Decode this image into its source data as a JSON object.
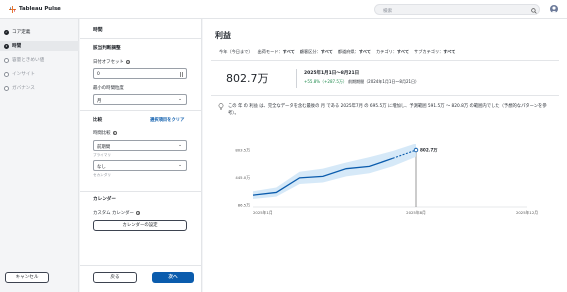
{
  "app": {
    "brand": "Tableau Pulse",
    "search_placeholder": "検索"
  },
  "steps": [
    {
      "label": "コア定義",
      "state": "done"
    },
    {
      "label": "時間",
      "state": "active"
    },
    {
      "label": "容量ときめい値",
      "state": "todo"
    },
    {
      "label": "インサイト",
      "state": "todo"
    },
    {
      "label": "ガバナンス",
      "state": "todo"
    }
  ],
  "config": {
    "title": "時間",
    "section1": "該当判断調整",
    "offset_label": "日付オフセット",
    "offset_value": "0",
    "granularity_label": "最小の時間粒度",
    "granularity_value": "月",
    "compare_head": "比較",
    "clear_link": "選択項目をクリア",
    "time_compare_label": "時間比較",
    "time_compare_value": "前期間",
    "primary_sub": "プライマリ",
    "second_value": "なし",
    "secondary_sub": "セカンダリ",
    "calendar_head": "カレンダー",
    "custom_cal_label": "カスタム カレンダー",
    "custom_cal_button": "カレンダーの設定",
    "cancel": "キャンセル",
    "back": "戻る",
    "next": "次へ"
  },
  "preview": {
    "title": "利益",
    "filters": [
      {
        "name": "今年（今日まで）",
        "value": ""
      },
      {
        "name": "出荷モード",
        "value": "すべて"
      },
      {
        "name": "顧客区分",
        "value": "すべて"
      },
      {
        "name": "都道府県",
        "value": "すべて"
      },
      {
        "name": "カテゴリ",
        "value": "すべて"
      },
      {
        "name": "サブカテゴリ",
        "value": "すべて"
      }
    ],
    "big_value": "802.7万",
    "range": "2025年1月1日～8月21日",
    "delta_up": "+55.8%（+287.5万）",
    "delta_rest": " 前期期間（2024年1月1日～8月21日）",
    "insight_text": "この 年 の 利益 は、完全なデータを含む最後の 月 である 2025年7月 の 695.5万 に増加し、予測範囲 591.5万 ～ 820.8万 の範囲内でした（予想的なパターンを参考）。",
    "accent": "#0b5cad"
  },
  "chart_data": {
    "type": "line",
    "yticks": [
      "803.5万",
      "445.0万",
      "86.5万"
    ],
    "xticks": [
      "2025年1月",
      "2025年8月",
      "2025年12月"
    ],
    "end_label": "802.7万",
    "ylim": [
      86.5,
      803.5
    ],
    "x": [
      0,
      1,
      2,
      3,
      4,
      5,
      6,
      7
    ],
    "values": [
      215,
      250,
      440,
      460,
      560,
      590,
      695,
      802.7
    ],
    "band_upper": [
      265,
      315,
      520,
      560,
      640,
      710,
      790,
      890
    ],
    "band_lower": [
      165,
      195,
      360,
      380,
      460,
      500,
      591.5,
      715
    ],
    "forecast_from": 6
  }
}
